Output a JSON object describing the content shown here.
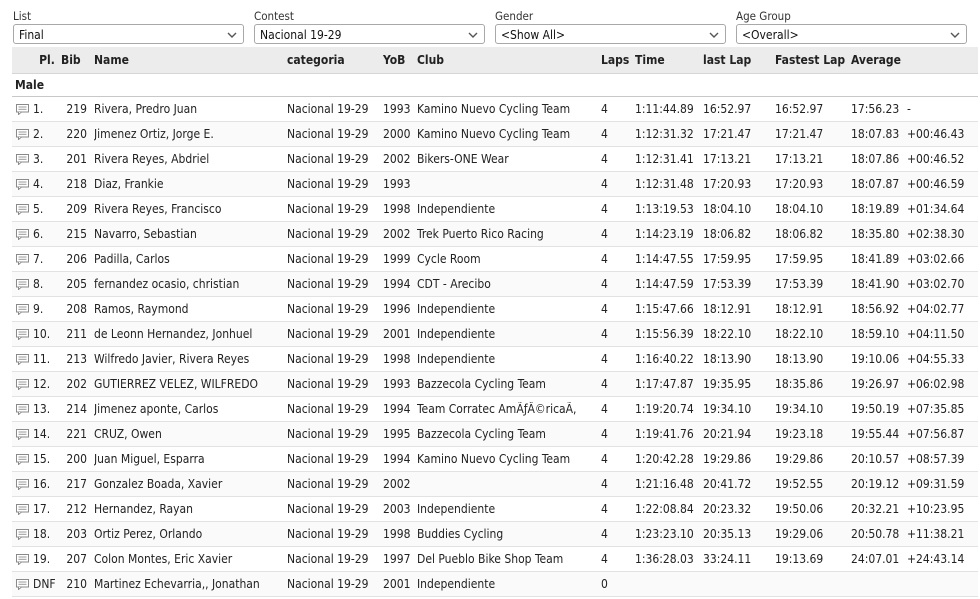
{
  "filters": {
    "list": {
      "label": "List",
      "value": "Final"
    },
    "contest": {
      "label": "Contest",
      "value": "Nacional 19-29"
    },
    "gender": {
      "label": "Gender",
      "value": "<Show All>"
    },
    "age_group": {
      "label": "Age Group",
      "value": "<Overall>"
    }
  },
  "table": {
    "headers": {
      "pl": "Pl.",
      "bib": "Bib",
      "name": "Name",
      "categoria": "categoria",
      "yob": "YoB",
      "club": "Club",
      "laps": "Laps",
      "time": "Time",
      "last_lap": "last Lap",
      "fastest_lap": "Fastest Lap",
      "average": "Average"
    },
    "group": "Male",
    "rows": [
      {
        "pl": "1.",
        "bib": "219",
        "name": "Rivera, Predro Juan",
        "categoria": "Nacional 19-29",
        "yob": "1993",
        "club": "Kamino Nuevo Cycling Team",
        "laps": "4",
        "time": "1:11:44.89",
        "last": "16:52.97",
        "fast": "16:52.97",
        "avg": "17:56.23",
        "gap": "-"
      },
      {
        "pl": "2.",
        "bib": "220",
        "name": "Jimenez Ortiz, Jorge E.",
        "categoria": "Nacional 19-29",
        "yob": "2000",
        "club": "Kamino Nuevo Cycling Team",
        "laps": "4",
        "time": "1:12:31.32",
        "last": "17:21.47",
        "fast": "17:21.47",
        "avg": "18:07.83",
        "gap": "+00:46.43"
      },
      {
        "pl": "3.",
        "bib": "201",
        "name": "Rivera Reyes, Abdriel",
        "categoria": "Nacional 19-29",
        "yob": "2002",
        "club": "Bikers-ONE Wear",
        "laps": "4",
        "time": "1:12:31.41",
        "last": "17:13.21",
        "fast": "17:13.21",
        "avg": "18:07.86",
        "gap": "+00:46.52"
      },
      {
        "pl": "4.",
        "bib": "218",
        "name": "Diaz, Frankie",
        "categoria": "Nacional 19-29",
        "yob": "1993",
        "club": "",
        "laps": "4",
        "time": "1:12:31.48",
        "last": "17:20.93",
        "fast": "17:20.93",
        "avg": "18:07.87",
        "gap": "+00:46.59"
      },
      {
        "pl": "5.",
        "bib": "209",
        "name": "Rivera Reyes, Francisco",
        "categoria": "Nacional 19-29",
        "yob": "1998",
        "club": "Independiente",
        "laps": "4",
        "time": "1:13:19.53",
        "last": "18:04.10",
        "fast": "18:04.10",
        "avg": "18:19.89",
        "gap": "+01:34.64"
      },
      {
        "pl": "6.",
        "bib": "215",
        "name": "Navarro, Sebastian",
        "categoria": "Nacional 19-29",
        "yob": "2002",
        "club": "Trek Puerto Rico Racing",
        "laps": "4",
        "time": "1:14:23.19",
        "last": "18:06.82",
        "fast": "18:06.82",
        "avg": "18:35.80",
        "gap": "+02:38.30"
      },
      {
        "pl": "7.",
        "bib": "206",
        "name": "Padilla, Carlos",
        "categoria": "Nacional 19-29",
        "yob": "1999",
        "club": "Cycle Room",
        "laps": "4",
        "time": "1:14:47.55",
        "last": "17:59.95",
        "fast": "17:59.95",
        "avg": "18:41.89",
        "gap": "+03:02.66"
      },
      {
        "pl": "8.",
        "bib": "205",
        "name": "fernandez ocasio, christian",
        "categoria": "Nacional 19-29",
        "yob": "1994",
        "club": "CDT - Arecibo",
        "laps": "4",
        "time": "1:14:47.59",
        "last": "17:53.39",
        "fast": "17:53.39",
        "avg": "18:41.90",
        "gap": "+03:02.70"
      },
      {
        "pl": "9.",
        "bib": "208",
        "name": "Ramos, Raymond",
        "categoria": "Nacional 19-29",
        "yob": "1996",
        "club": "Independiente",
        "laps": "4",
        "time": "1:15:47.66",
        "last": "18:12.91",
        "fast": "18:12.91",
        "avg": "18:56.92",
        "gap": "+04:02.77"
      },
      {
        "pl": "10.",
        "bib": "211",
        "name": "de Leonn Hernandez, Jonhuel",
        "categoria": "Nacional 19-29",
        "yob": "2001",
        "club": "Independiente",
        "laps": "4",
        "time": "1:15:56.39",
        "last": "18:22.10",
        "fast": "18:22.10",
        "avg": "18:59.10",
        "gap": "+04:11.50"
      },
      {
        "pl": "11.",
        "bib": "213",
        "name": "Wilfredo Javier, Rivera Reyes",
        "categoria": "Nacional 19-29",
        "yob": "1998",
        "club": "Independiente",
        "laps": "4",
        "time": "1:16:40.22",
        "last": "18:13.90",
        "fast": "18:13.90",
        "avg": "19:10.06",
        "gap": "+04:55.33"
      },
      {
        "pl": "12.",
        "bib": "202",
        "name": "GUTIERREZ VELEZ, WILFREDO",
        "categoria": "Nacional 19-29",
        "yob": "1993",
        "club": "Bazzecola Cycling Team",
        "laps": "4",
        "time": "1:17:47.87",
        "last": "19:35.95",
        "fast": "18:35.86",
        "avg": "19:26.97",
        "gap": "+06:02.98"
      },
      {
        "pl": "13.",
        "bib": "214",
        "name": "Jimenez aponte, Carlos",
        "categoria": "Nacional 19-29",
        "yob": "1994",
        "club": "Team Corratec AmÃƒÂ©ricaÃ,",
        "laps": "4",
        "time": "1:19:20.74",
        "last": "19:34.10",
        "fast": "19:34.10",
        "avg": "19:50.19",
        "gap": "+07:35.85"
      },
      {
        "pl": "14.",
        "bib": "221",
        "name": "CRUZ, Owen",
        "categoria": "Nacional 19-29",
        "yob": "1995",
        "club": "Bazzecola Cycling Team",
        "laps": "4",
        "time": "1:19:41.76",
        "last": "20:21.94",
        "fast": "19:23.18",
        "avg": "19:55.44",
        "gap": "+07:56.87"
      },
      {
        "pl": "15.",
        "bib": "200",
        "name": "Juan Miguel, Esparra",
        "categoria": "Nacional 19-29",
        "yob": "1994",
        "club": "Kamino Nuevo Cycling Team",
        "laps": "4",
        "time": "1:20:42.28",
        "last": "19:29.86",
        "fast": "19:29.86",
        "avg": "20:10.57",
        "gap": "+08:57.39"
      },
      {
        "pl": "16.",
        "bib": "217",
        "name": "Gonzalez Boada, Xavier",
        "categoria": "Nacional 19-29",
        "yob": "2002",
        "club": "",
        "laps": "4",
        "time": "1:21:16.48",
        "last": "20:41.72",
        "fast": "19:52.55",
        "avg": "20:19.12",
        "gap": "+09:31.59"
      },
      {
        "pl": "17.",
        "bib": "212",
        "name": "Hernandez, Rayan",
        "categoria": "Nacional 19-29",
        "yob": "2003",
        "club": "Independiente",
        "laps": "4",
        "time": "1:22:08.84",
        "last": "20:23.32",
        "fast": "19:50.06",
        "avg": "20:32.21",
        "gap": "+10:23.95"
      },
      {
        "pl": "18.",
        "bib": "203",
        "name": "Ortiz Perez, Orlando",
        "categoria": "Nacional 19-29",
        "yob": "1998",
        "club": "Buddies Cycling",
        "laps": "4",
        "time": "1:23:23.10",
        "last": "20:35.13",
        "fast": "19:29.06",
        "avg": "20:50.78",
        "gap": "+11:38.21"
      },
      {
        "pl": "19.",
        "bib": "207",
        "name": "Colon Montes, Eric Xavier",
        "categoria": "Nacional 19-29",
        "yob": "1997",
        "club": "Del Pueblo Bike Shop Team",
        "laps": "4",
        "time": "1:36:28.03",
        "last": "33:24.11",
        "fast": "19:13.69",
        "avg": "24:07.01",
        "gap": "+24:43.14"
      },
      {
        "pl": "DNF",
        "bib": "210",
        "name": "Martinez Echevarria,, Jonathan",
        "categoria": "Nacional 19-29",
        "yob": "2001",
        "club": "Independiente",
        "laps": "0",
        "time": "",
        "last": "",
        "fast": "",
        "avg": "",
        "gap": ""
      }
    ]
  },
  "icons": {
    "row_comment": "speech-bubble-icon",
    "favorite": "star-outline-icon",
    "dropdown": "chevron-down-icon"
  },
  "colors": {
    "header_bg": "#ececec",
    "border": "#a8a8a8",
    "text": "#222222",
    "star": "#b0b0b0"
  }
}
